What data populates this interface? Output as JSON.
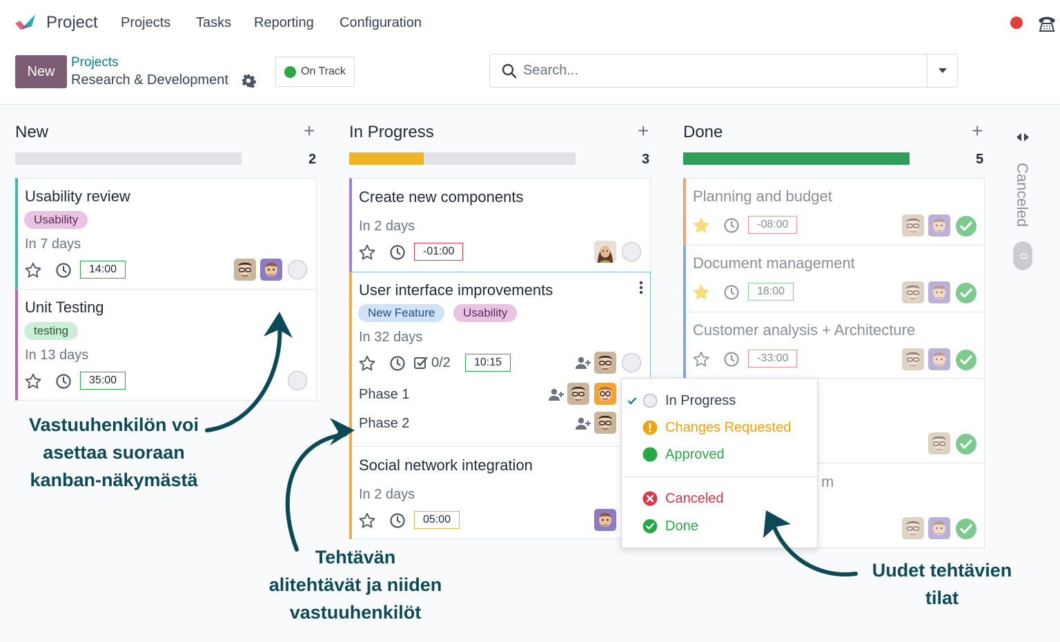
{
  "nav": {
    "app_name": "Project",
    "menu": [
      "Projects",
      "Tasks",
      "Reporting",
      "Configuration"
    ]
  },
  "control": {
    "new_label": "New",
    "breadcrumb_parent": "Projects",
    "breadcrumb_current": "Research & Development",
    "status_label": "On Track",
    "search_placeholder": "Search..."
  },
  "columns": [
    {
      "title": "New",
      "count": "2",
      "progress": 0
    },
    {
      "title": "In Progress",
      "count": "3",
      "progress": 0.33
    },
    {
      "title": "Done",
      "count": "5",
      "progress": 1.0
    }
  ],
  "folded_column": {
    "title": "Canceled",
    "count": "0"
  },
  "cards": {
    "usability_review": {
      "title": "Usability review",
      "tag": "Usability",
      "deadline": "In 7 days",
      "time": "14:00"
    },
    "unit_testing": {
      "title": "Unit Testing",
      "tag": "testing",
      "deadline": "In 13 days",
      "time": "35:00"
    },
    "create_components": {
      "title": "Create new components",
      "deadline": "In 2 days",
      "time": "-01:00"
    },
    "ui_improvements": {
      "title": "User interface improvements",
      "tags": [
        "New Feature",
        "Usability"
      ],
      "deadline": "In 32 days",
      "subtasks_count": "0/2",
      "time": "10:15",
      "subtasks": [
        "Phase 1",
        "Phase 2"
      ]
    },
    "social_network": {
      "title": "Social network integration",
      "deadline": "In 2 days",
      "time": "05:00"
    },
    "planning_budget": {
      "title": "Planning and budget",
      "time": "-08:00"
    },
    "document_mgmt": {
      "title": "Document management",
      "time": "18:00"
    },
    "customer_analysis": {
      "title": "Customer analysis + Architecture",
      "time": "-33:00"
    },
    "hidden_title_tail": "m"
  },
  "status_menu": {
    "items": [
      {
        "label": "In Progress",
        "color": "#374151"
      },
      {
        "label": "Changes Requested",
        "color": "#f0a30a"
      },
      {
        "label": "Approved",
        "color": "#28a745"
      },
      {
        "label": "Canceled",
        "color": "#dc3545"
      },
      {
        "label": "Done",
        "color": "#28a745"
      }
    ]
  },
  "annotations": {
    "assignee": [
      "Vastuuhenkilön voi",
      "asettaa suoraan",
      "kanban-näkymästä"
    ],
    "subtasks": [
      "Tehtävän",
      "alitehtävät ja niiden",
      "vastuuhenkilöt"
    ],
    "states": [
      "Uudet tehtävien",
      "tilat"
    ]
  },
  "colors": {
    "brand": "#7c5d73",
    "link": "#017e84",
    "annotation": "#0c4a57",
    "progress_in_progress": "#f0b429",
    "progress_done": "#2e9e5b"
  }
}
